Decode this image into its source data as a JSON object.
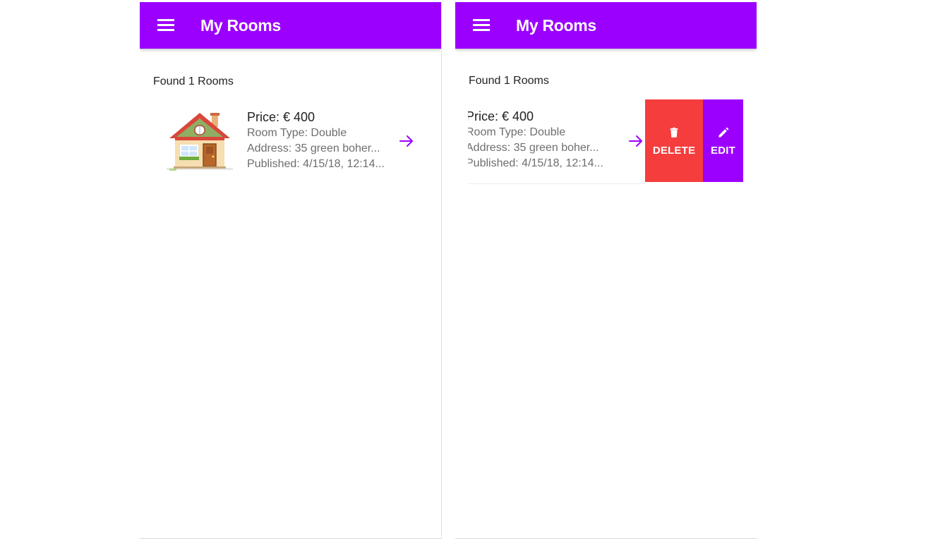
{
  "colors": {
    "primary": "#9b00ff",
    "danger": "#f53d3d",
    "toolbar_text": "#ffffff"
  },
  "screens": [
    {
      "header": {
        "title": "My Rooms",
        "menu_icon": "menu-icon"
      },
      "found_text": "Found 1 Rooms",
      "room": {
        "price": "Price: € 400",
        "room_type": "Room Type: Double",
        "address": "Address: 35 green boher...",
        "published": "Published: 4/15/18, 12:14...",
        "thumbnail_icon": "house-icon",
        "arrow_icon": "arrow-forward-icon"
      }
    },
    {
      "header": {
        "title": "My Rooms",
        "menu_icon": "menu-icon"
      },
      "found_text": "Found 1 Rooms",
      "room": {
        "price": "Price: € 400",
        "room_type": "Room Type: Double",
        "address": "Address: 35 green boher...",
        "published": "Published: 4/15/18, 12:14...",
        "arrow_icon": "arrow-forward-icon"
      },
      "options": {
        "delete_label": "DELETE",
        "delete_icon": "trash-icon",
        "edit_label": "EDIT",
        "edit_icon": "pencil-icon"
      }
    }
  ]
}
